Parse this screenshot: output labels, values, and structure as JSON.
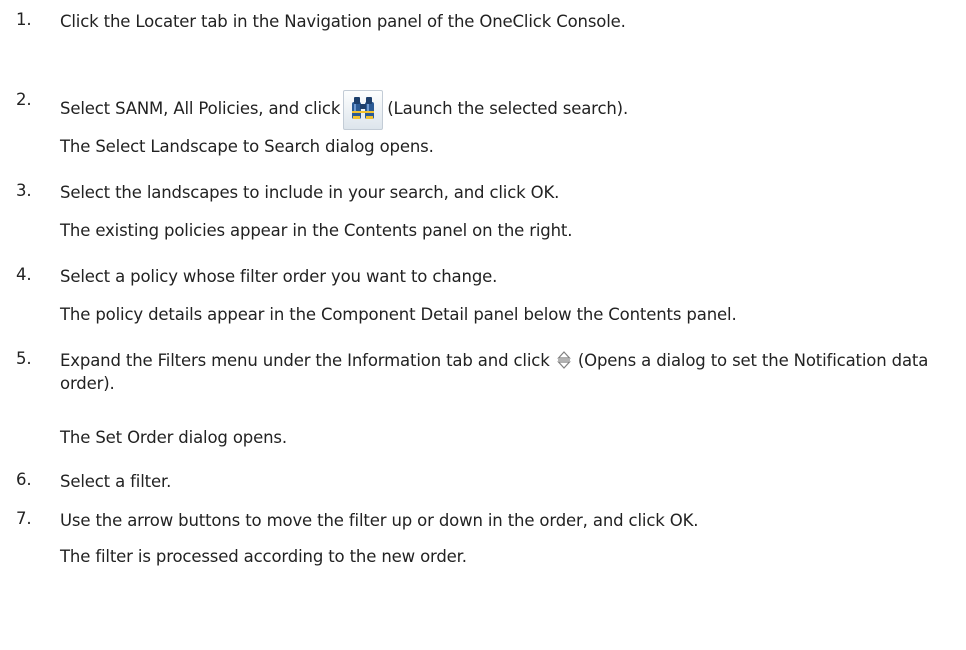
{
  "steps": [
    {
      "number": "1.",
      "text": "Click the Locater tab in the Navigation panel of the OneClick Console."
    },
    {
      "number": "2.",
      "text_before": "Select SANM, All Policies, and click",
      "icon": "binoculars-icon",
      "text_after": "(Launch the selected search).",
      "result": "The Select Landscape to Search dialog opens."
    },
    {
      "number": "3.",
      "text": "Select the landscapes to include in your search, and click OK.",
      "result": "The existing policies appear in the Contents panel on the right."
    },
    {
      "number": "4.",
      "text": "Select a policy whose filter order you want to change.",
      "result": "The policy details appear in the Component Detail panel below the Contents panel."
    },
    {
      "number": "5.",
      "text_before": "Expand the Filters menu under the Information tab and click",
      "icon": "up-down-arrows-icon",
      "text_after": "(Opens a dialog to set the Notification data order).",
      "result": "The Set Order dialog opens."
    },
    {
      "number": "6.",
      "text": "Select a filter."
    },
    {
      "number": "7.",
      "text": "Use the arrow buttons to move the filter up or down in the order, and click OK.",
      "result": "The filter is processed according to the new order."
    }
  ]
}
